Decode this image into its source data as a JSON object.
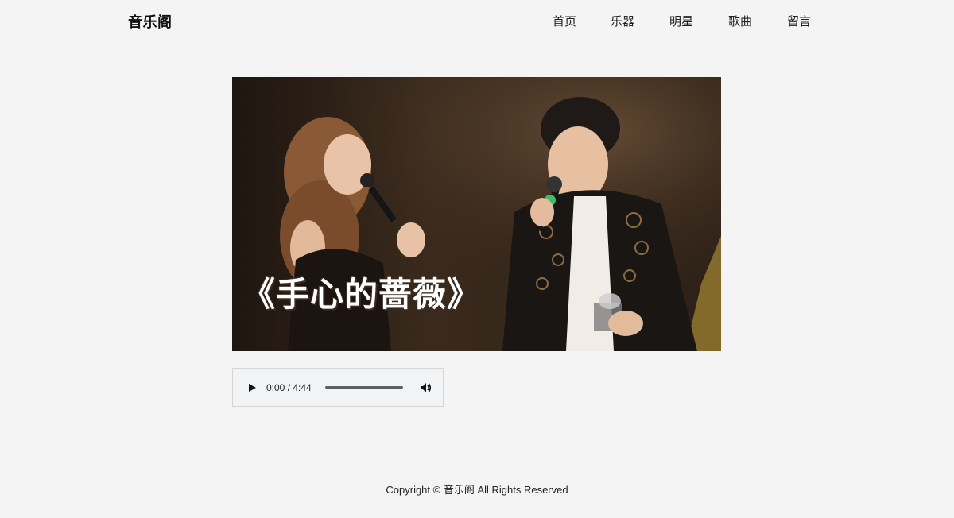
{
  "header": {
    "logo": "音乐阁",
    "nav": [
      {
        "label": "首页"
      },
      {
        "label": "乐器"
      },
      {
        "label": "明星"
      },
      {
        "label": "歌曲"
      },
      {
        "label": "留言"
      }
    ]
  },
  "video": {
    "overlay_title": "《手心的蔷薇》"
  },
  "audio": {
    "time_display": "0:00 / 4:44",
    "progress_fraction": 0,
    "play_icon": "play-icon",
    "volume_icon": "volume-icon"
  },
  "footer": {
    "copyright": "Copyright © 音乐阁 All Rights Reserved"
  },
  "colors": {
    "background": "#f4f4f4",
    "player_bg": "#f1f3f4",
    "text": "#222222"
  }
}
